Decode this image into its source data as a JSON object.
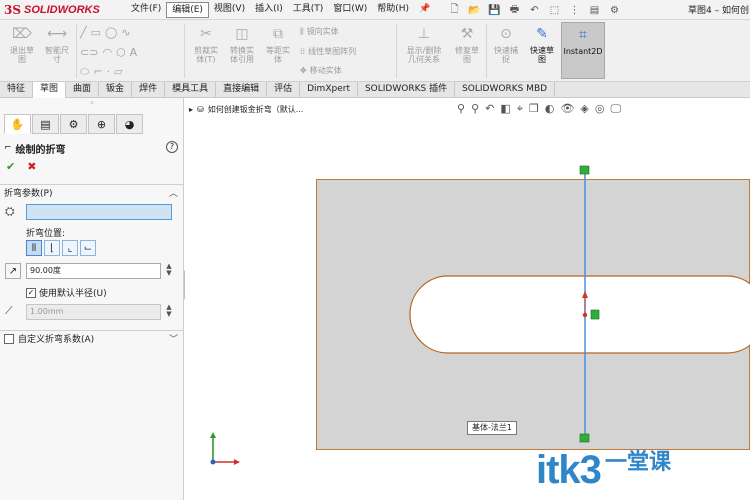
{
  "app": {
    "logo_text": "SOLIDWORKS",
    "document_title": "草图4 – 如何创"
  },
  "menus": [
    "文件(F)",
    "编辑(E)",
    "视图(V)",
    "插入(I)",
    "工具(T)",
    "窗口(W)",
    "帮助(H)"
  ],
  "active_menu_index": 1,
  "ribbon": {
    "exit_sketch": "退出草\n图",
    "smart_dim": "智能尺\n寸",
    "trim": "剪裁实\n体(T)",
    "convert": "转换实\n体引用",
    "offset": "等距实\n体",
    "mirror": "镜向实体",
    "linear_pattern": "线性草图阵列",
    "move": "移动实体",
    "display_delete": "显示/删除\n几何关系",
    "repair": "修复草\n图",
    "quick_snap": "快速捕\n捉",
    "rapid_sketch": "快速草\n图",
    "instant2d": "Instant2D"
  },
  "tabs": [
    "特征",
    "草图",
    "曲面",
    "钣金",
    "焊件",
    "模具工具",
    "直接编辑",
    "评估",
    "DimXpert",
    "SOLIDWORKS 插件",
    "SOLIDWORKS MBD"
  ],
  "active_tab_index": 1,
  "panel": {
    "title": "绘制的折弯",
    "section_params": "折弯参数(P)",
    "edge_value": "",
    "bend_position_label": "折弯位置:",
    "angle_value": "90.00度",
    "use_default_radius_label": "使用默认半径(U)",
    "use_default_radius_checked": true,
    "radius_value": "1.00mm",
    "custom_bend_label": "自定义折弯系数(A)",
    "custom_bend_checked": false
  },
  "graphics": {
    "tree_label": "如何创建钣金折弯（默认...",
    "callout_label": "基体-法兰1"
  },
  "watermark": {
    "main": "itk3",
    "sub": "一堂课"
  }
}
